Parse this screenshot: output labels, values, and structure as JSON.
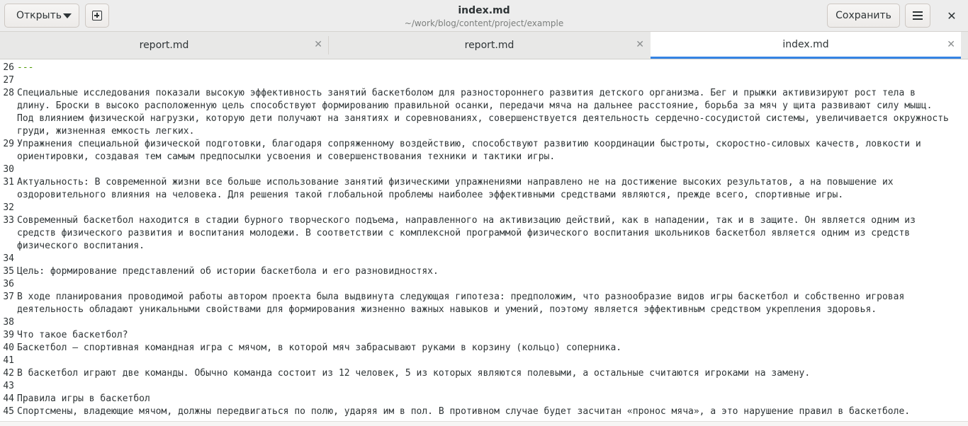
{
  "header": {
    "open_label": "Открыть",
    "title": "index.md",
    "subtitle": "~/work/blog/content/project/example",
    "save_label": "Сохранить",
    "close_glyph": "✕"
  },
  "tabs": [
    {
      "label": "report.md",
      "close": "✕"
    },
    {
      "label": "report.md",
      "close": "✕"
    },
    {
      "label": "index.md",
      "close": "✕"
    }
  ],
  "editor": {
    "lines": [
      {
        "n": "26",
        "text": "---"
      },
      {
        "n": "27",
        "text": ""
      },
      {
        "n": "28",
        "text": "Специальные исследования показали высокую эффективность занятий баскетболом для разностороннего развития детского организма. Бег и прыжки активизируют рост тела в длину. Броски в высоко расположенную цель способствуют формированию правильной осанки, передачи мяча на дальнее расстояние, борьба за мяч у щита развивают силу мышц. Под влиянием физической нагрузки, которую дети получают на занятиях и соревнованиях, совершенствуется деятельность сердечно-сосудистой системы, увеличивается окружность груди, жизненная емкость легких."
      },
      {
        "n": "29",
        "text": "Упражнения специальной физической подготовки, благодаря сопряженному воздействию, способствуют развитию координации быстроты, скоростно-силовых качеств, ловкости и ориентировки, создавая тем самым предпосылки усвоения и совершенствования техники и тактики игры."
      },
      {
        "n": "30",
        "text": ""
      },
      {
        "n": "31",
        "text": "Актуальность: В современной жизни все больше использование занятий физическими упражнениями направлено не на достижение высоких результатов, а на повышение их оздоровительного влияния на человека. Для решения такой глобальной проблемы наиболее эффективными средствами являются, прежде всего, спортивные игры."
      },
      {
        "n": "32",
        "text": ""
      },
      {
        "n": "33",
        "text": "Современный баскетбол находится в стадии бурного творческого подъема, направленного на активизацию действий, как в нападении, так и в защите. Он является одним из средств физического развития и воспитания молодежи. В соответствии с комплексной программой физического воспитания школьников баскетбол является одним из средств физического воспитания."
      },
      {
        "n": "34",
        "text": ""
      },
      {
        "n": "35",
        "text": "Цель: формирование представлений об истории баскетбола и его разновидностях."
      },
      {
        "n": "36",
        "text": ""
      },
      {
        "n": "37",
        "text": "В ходе планирования проводимой работы автором проекта была выдвинута следующая гипотеза: предположим, что разнообразие видов игры баскетбол и собственно игровая деятельность обладают уникальными свойствами для формирования жизненно важных навыков и умений, поэтому является эффективным средством укрепления здоровья."
      },
      {
        "n": "38",
        "text": ""
      },
      {
        "n": "39",
        "text": "Что такое баскетбол?"
      },
      {
        "n": "40",
        "text": "Баскетбол — спортивная командная игра с мячом, в которой мяч забрасывают руками в корзину (кольцо) соперника."
      },
      {
        "n": "41",
        "text": ""
      },
      {
        "n": "42",
        "text": "В баскетбол играют две команды. Обычно команда состоит из 12 человек, 5 из которых являются полевыми, а остальные считаются игроками на замену."
      },
      {
        "n": "43",
        "text": ""
      },
      {
        "n": "44",
        "text": "Правила игры в баскетбол"
      },
      {
        "n": "45",
        "text": "Спортсмены, владеющие мячом, должны передвигаться по полю, ударяя им в пол. В противном случае будет засчитан «пронос мяча», а это нарушение правил в баскетболе."
      }
    ]
  }
}
